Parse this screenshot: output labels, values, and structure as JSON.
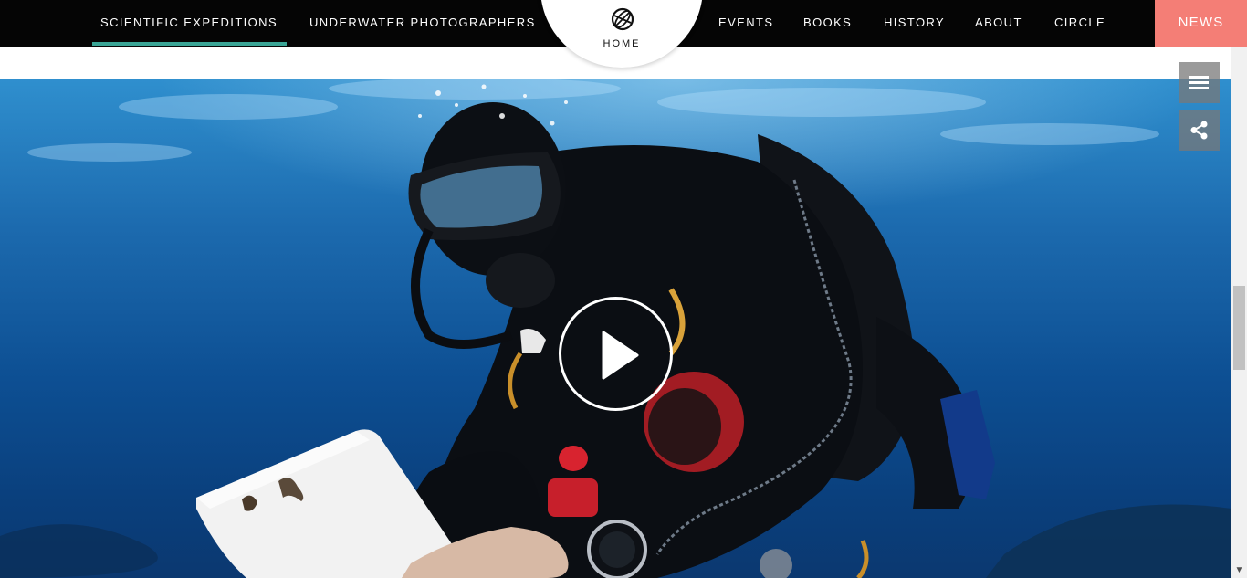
{
  "nav": {
    "left_links": [
      {
        "label": "SCIENTIFIC EXPEDITIONS",
        "active": true
      },
      {
        "label": "UNDERWATER PHOTOGRAPHERS",
        "active": false
      }
    ],
    "home_label": "HOME",
    "right_links": [
      {
        "label": "EVENTS"
      },
      {
        "label": "BOOKS"
      },
      {
        "label": "HISTORY"
      },
      {
        "label": "ABOUT"
      },
      {
        "label": "CIRCLE"
      }
    ],
    "news_label": "NEWS"
  },
  "hero": {
    "play_icon": "play-icon"
  },
  "side_buttons": {
    "menu_icon": "hamburger-menu-icon",
    "share_icon": "share-icon"
  },
  "colors": {
    "nav_bg": "#050505",
    "active_underline": "#3aa596",
    "news_bg": "#f47e76",
    "water": "#1c6aae"
  }
}
